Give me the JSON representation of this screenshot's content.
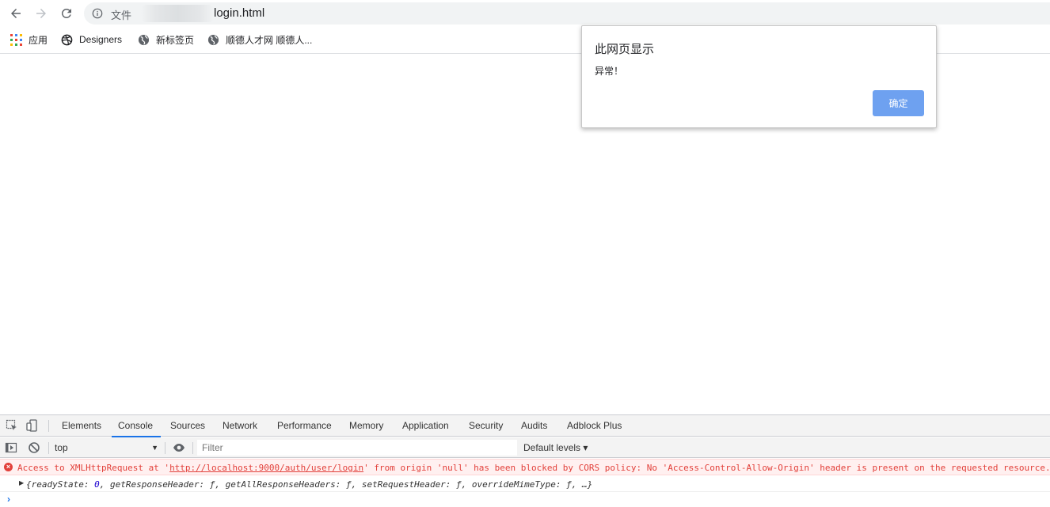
{
  "address_bar": {
    "scheme_label": "文件",
    "url": "login.html"
  },
  "bookmarks": [
    {
      "label": "应用",
      "icon": "apps-grid-icon"
    },
    {
      "label": "Designers",
      "icon": "dribbble-icon"
    },
    {
      "label": "新标签页",
      "icon": "globe-icon"
    },
    {
      "label": "顺德人才网 顺德人...",
      "icon": "globe-icon"
    }
  ],
  "dialog": {
    "title": "此网页显示",
    "message": "异常！",
    "ok_label": "确定",
    "ok_color": "#6ea1f0"
  },
  "devtools": {
    "tabs": [
      "Elements",
      "Console",
      "Sources",
      "Network",
      "Performance",
      "Memory",
      "Application",
      "Security",
      "Audits",
      "Adblock Plus"
    ],
    "active_tab": "Console",
    "context": "top",
    "filter_placeholder": "Filter",
    "levels_label": "Default levels ▾",
    "error": {
      "prefix": "Access to XMLHttpRequest at '",
      "link": "http://localhost:9000/auth/user/login",
      "suffix": "' from origin 'null' has been blocked by CORS policy: No 'Access-Control-Allow-Origin' header is present on the requested resource.",
      "color": "#e2403a"
    },
    "log": {
      "open": "{readyState: ",
      "ready_state": "0",
      "rest": ", getResponseHeader: ƒ, getAllResponseHeaders: ƒ, setRequestHeader: ƒ, overrideMimeType: ƒ, …}"
    },
    "prompt": "›"
  },
  "colors": {
    "accent": "#1a73e8",
    "omnibox_bg": "#f1f3f4"
  }
}
